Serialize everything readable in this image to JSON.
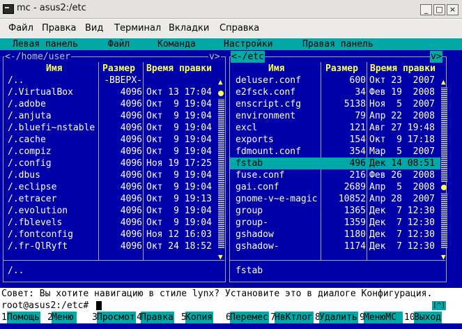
{
  "window": {
    "title": "mc - asus2:/etc",
    "buttons": [
      "_",
      "□",
      "×"
    ]
  },
  "menubar": [
    "Файл",
    "Правка",
    "Вид",
    "Терминал",
    "Вкладки",
    "Справка"
  ],
  "mc_menu": [
    "Левая панель",
    "Файл",
    "Команда",
    "Настройки",
    "Правая панель"
  ],
  "left_panel": {
    "path": "<-/home/user",
    "corner": "v>",
    "headers": {
      "name": "Имя",
      "size": "Размер",
      "mtime": "Время правки"
    },
    "rows": [
      {
        "name": "/..",
        "size": "-ВВЕРХ-",
        "mtime": ""
      },
      {
        "name": "/.VirtualBox",
        "size": "4096",
        "mtime": "Окт 13 17:04"
      },
      {
        "name": "/.adobe",
        "size": "4096",
        "mtime": "Окт  9 19:04"
      },
      {
        "name": "/.anjuta",
        "size": "4096",
        "mtime": "Окт  9 19:04"
      },
      {
        "name": "/.bluefi~nstable",
        "size": "4096",
        "mtime": "Окт  9 19:04"
      },
      {
        "name": "/.cache",
        "size": "4096",
        "mtime": "Окт  9 19:04"
      },
      {
        "name": "/.compiz",
        "size": "4096",
        "mtime": "Окт  9 19:04"
      },
      {
        "name": "/.config",
        "size": "4096",
        "mtime": "Ноя 19 17:25"
      },
      {
        "name": "/.dbus",
        "size": "4096",
        "mtime": "Окт  9 19:04"
      },
      {
        "name": "/.eclipse",
        "size": "4096",
        "mtime": "Окт  9 19:04"
      },
      {
        "name": "/.etracer",
        "size": "4096",
        "mtime": "Окт  9 19:13"
      },
      {
        "name": "/.evolution",
        "size": "4096",
        "mtime": "Окт  9 19:04"
      },
      {
        "name": "/.fblevels",
        "size": "4096",
        "mtime": "Окт  9 19:04"
      },
      {
        "name": "/.fontconfig",
        "size": "4096",
        "mtime": "Ноя 12 16:03"
      },
      {
        "name": "/.fr-QlRyft",
        "size": "4096",
        "mtime": "Окт 24 18:52"
      }
    ],
    "status": "/.."
  },
  "right_panel": {
    "path": "<-/etc",
    "corner": "v>",
    "headers": {
      "name": "Имя",
      "size": "Размер",
      "mtime": "Время правки"
    },
    "rows": [
      {
        "name": "deluser.conf",
        "size": "600",
        "mtime": "Окт 23  2007"
      },
      {
        "name": "e2fsck.conf",
        "size": "34",
        "mtime": "Фев 19  2008"
      },
      {
        "name": "enscript.cfg",
        "size": "5138",
        "mtime": "Ноя  5  2007"
      },
      {
        "name": "environment",
        "size": "79",
        "mtime": "Апр 22  2008"
      },
      {
        "name": "excl",
        "size": "121",
        "mtime": "Авг 27 19:48"
      },
      {
        "name": "exports",
        "size": "154",
        "mtime": "Окт  9 17:18"
      },
      {
        "name": "fdmount.conf",
        "size": "354",
        "mtime": "Мар  5  2007"
      },
      {
        "name": "fstab",
        "size": "496",
        "mtime": "Дек 14 08:51"
      },
      {
        "name": "fuse.conf",
        "size": "216",
        "mtime": "Фев 26  2008"
      },
      {
        "name": "gai.conf",
        "size": "2689",
        "mtime": "Апр  5  2008"
      },
      {
        "name": "gnome-v~e-magic",
        "size": "10852",
        "mtime": "Апр 28  2007"
      },
      {
        "name": "group",
        "size": "1365",
        "mtime": "Дек  7 12:30"
      },
      {
        "name": "group-",
        "size": "1359",
        "mtime": "Дек  7 12:30"
      },
      {
        "name": "gshadow",
        "size": "1180",
        "mtime": "Дек  7 12:30"
      },
      {
        "name": "gshadow-",
        "size": "1174",
        "mtime": "Дек  7 12:30"
      }
    ],
    "status": "fstab"
  },
  "hint": "Совет: Вы хотите навигацию в стиле lynx? Установите это в диалоге Конфигурация.",
  "prompt": "root@asus2:/etc#",
  "history_button": "[^]",
  "fkeys": [
    {
      "num": "1",
      "label": "Помощь"
    },
    {
      "num": "2",
      "label": "Меню"
    },
    {
      "num": "3",
      "label": "Просмотр"
    },
    {
      "num": "4",
      "label": "Правка"
    },
    {
      "num": "5",
      "label": "Копия"
    },
    {
      "num": "6",
      "label": "Перемес"
    },
    {
      "num": "7",
      "label": "НвКтлог"
    },
    {
      "num": "8",
      "label": "Удалить"
    },
    {
      "num": "9",
      "label": "МенюМС"
    },
    {
      "num": "10",
      "label": "Выход"
    }
  ],
  "colors": {
    "term_bg": "#0000a8",
    "cyan": "#00a8a8",
    "header_yellow": "#ffff55"
  }
}
